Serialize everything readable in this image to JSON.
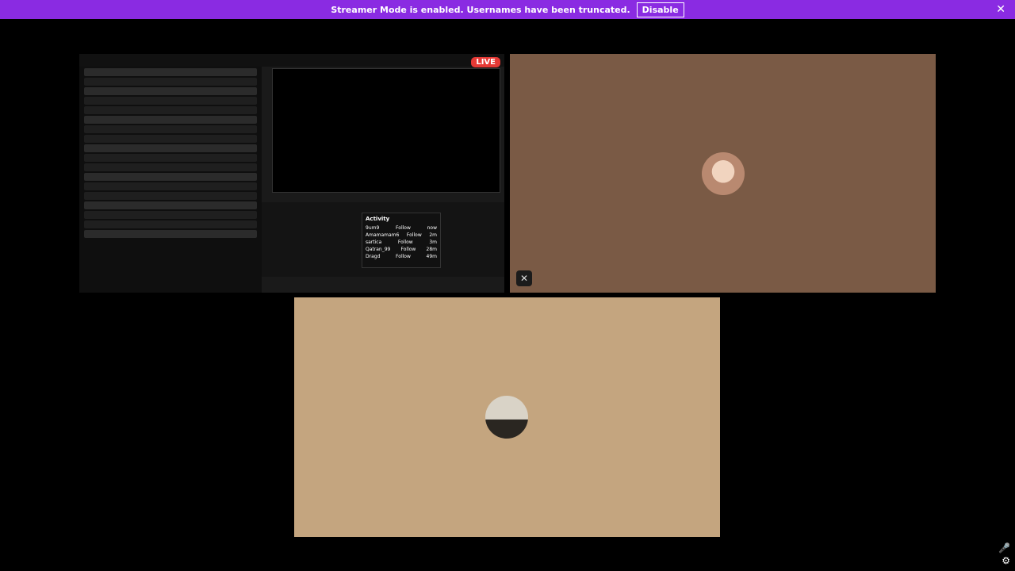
{
  "banner": {
    "message": "Streamer Mode is enabled. Usernames have been truncated.",
    "disable_label": "Disable"
  },
  "screen_share": {
    "live_label": "LIVE"
  },
  "activity_panel": {
    "title": "Activity",
    "items": [
      {
        "name": "9um9",
        "event": "Follow",
        "time": "now"
      },
      {
        "name": "Amamamam6",
        "event": "Follow",
        "time": "2m"
      },
      {
        "name": "sartica",
        "event": "Follow",
        "time": "3m"
      },
      {
        "name": "Qatran_99",
        "event": "Follow",
        "time": "28m"
      },
      {
        "name": "Dragd",
        "event": "Follow",
        "time": "49m"
      }
    ]
  },
  "icons": {
    "close": "close-icon",
    "mic_muted": "mic-muted-icon",
    "mic": "mic-icon",
    "settings": "settings-icon"
  }
}
